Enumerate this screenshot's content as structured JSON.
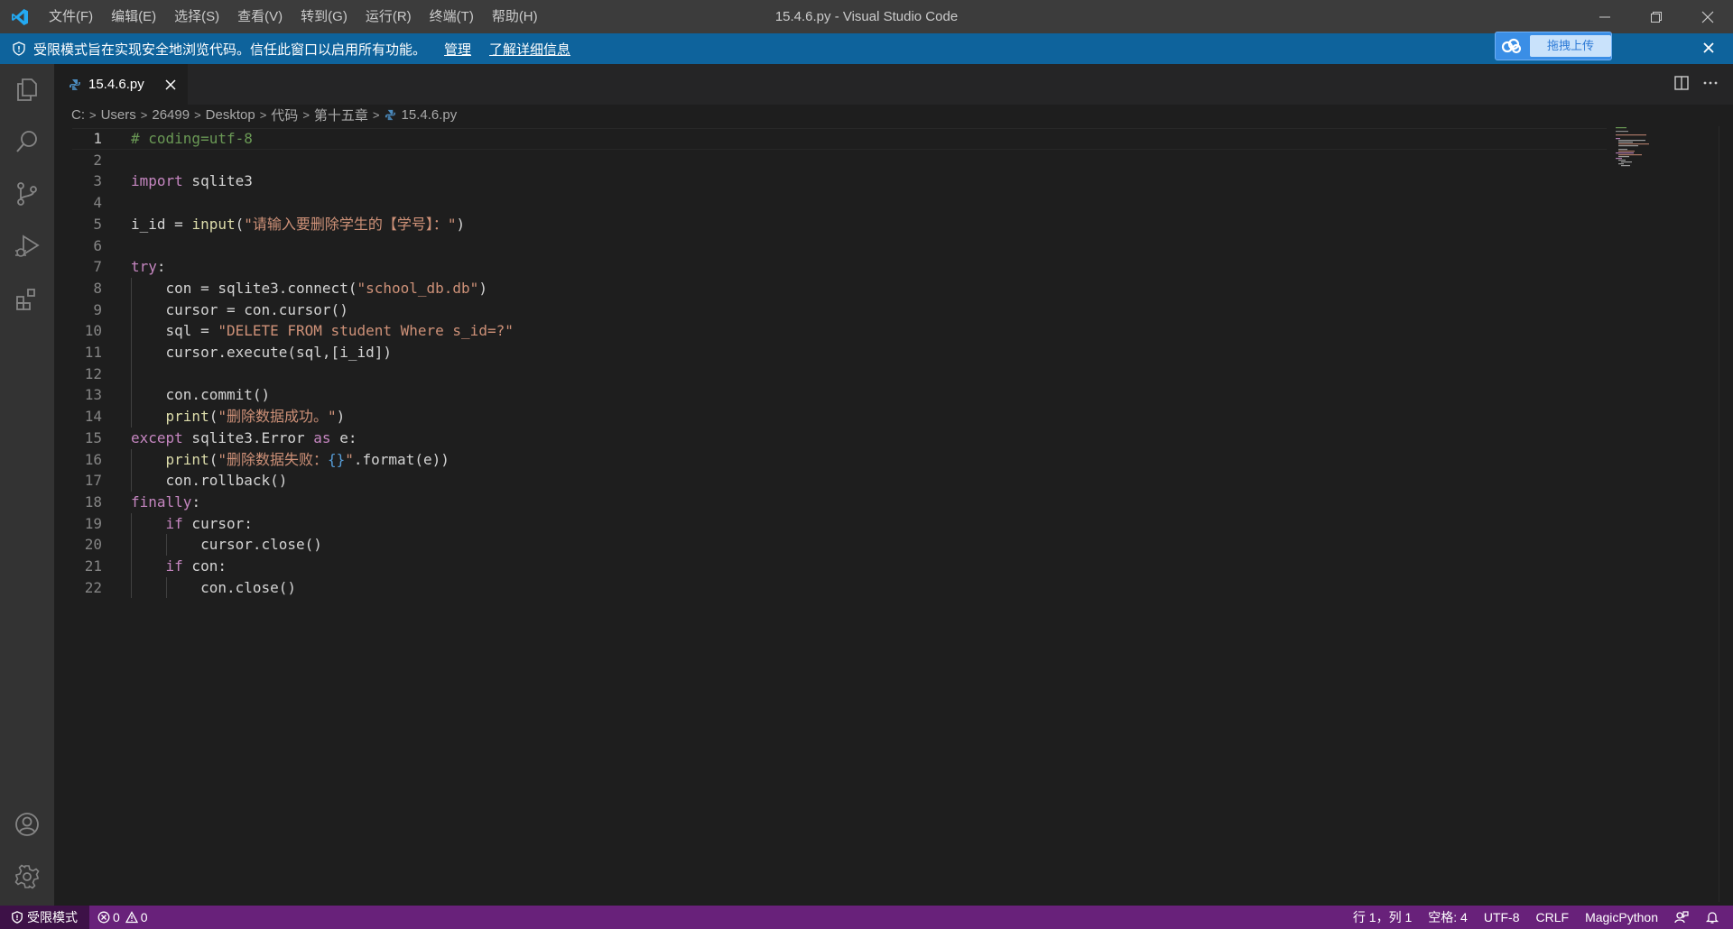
{
  "window": {
    "title": "15.4.6.py - Visual Studio Code"
  },
  "menu": [
    "文件(F)",
    "编辑(E)",
    "选择(S)",
    "查看(V)",
    "转到(G)",
    "运行(R)",
    "终端(T)",
    "帮助(H)"
  ],
  "banner": {
    "message": "受限模式旨在实现安全地浏览代码。信任此窗口以启用所有功能。",
    "manage": "管理",
    "learn_more": "了解详细信息",
    "upload_label": "拖拽上传"
  },
  "tabs": [
    {
      "label": "15.4.6.py",
      "active": true
    }
  ],
  "breadcrumb": [
    "C:",
    "Users",
    "26499",
    "Desktop",
    "代码",
    "第十五章",
    "15.4.6.py"
  ],
  "code": {
    "line_numbers": [
      "1",
      "2",
      "3",
      "4",
      "5",
      "6",
      "7",
      "8",
      "9",
      "10",
      "11",
      "12",
      "13",
      "14",
      "15",
      "16",
      "17",
      "18",
      "19",
      "20",
      "21",
      "22"
    ],
    "lines": [
      "# coding=utf-8",
      "",
      "import sqlite3",
      "",
      "i_id = input(\"请输入要删除学生的【学号】：\")",
      "",
      "try:",
      "    con = sqlite3.connect(\"school_db.db\")",
      "    cursor = con.cursor()",
      "    sql = \"DELETE FROM student Where s_id=?\"",
      "    cursor.execute(sql,[i_id])",
      "",
      "    con.commit()",
      "    print(\"删除数据成功。\")",
      "except sqlite3.Error as e:",
      "    print(\"删除数据失败：{}\".format(e))",
      "    con.rollback()",
      "finally:",
      "    if cursor:",
      "        cursor.close()",
      "    if con:",
      "        con.close()"
    ]
  },
  "statusbar": {
    "restricted": "受限模式",
    "errors": "0",
    "warnings": "0",
    "position": "行 1，列 1",
    "spaces": "空格: 4",
    "encoding": "UTF-8",
    "eol": "CRLF",
    "language": "MagicPython"
  },
  "colors": {
    "titlebar": "#3c3c3c",
    "banner": "#0e639c",
    "activitybar": "#333333",
    "editor": "#1e1e1e",
    "statusbar": "#68217a",
    "keyword": "#c586c0",
    "string": "#ce9178",
    "comment": "#6a9955"
  }
}
